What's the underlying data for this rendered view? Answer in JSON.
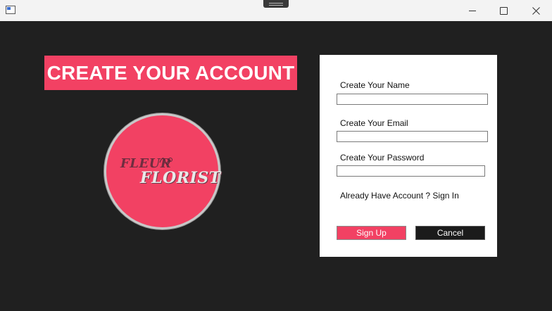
{
  "window": {
    "minimize_icon": "minimize-icon",
    "maximize_icon": "maximize-icon",
    "close_icon": "close-icon"
  },
  "header": {
    "title": "CREATE YOUR ACCOUNT"
  },
  "logo": {
    "line1": "FLEUR",
    "line2": "FLORIST"
  },
  "form": {
    "name_label": "Create Your Name",
    "name_value": "",
    "email_label": "Create Your Email",
    "email_value": "",
    "password_label": "Create Your Password",
    "password_value": "",
    "signin_link": "Already Have Account ? Sign In",
    "signup_button": "Sign Up",
    "cancel_button": "Cancel"
  },
  "colors": {
    "accent": "#f24163",
    "background": "#202020",
    "panel": "#ffffff",
    "cancel": "#1b1b1b"
  }
}
